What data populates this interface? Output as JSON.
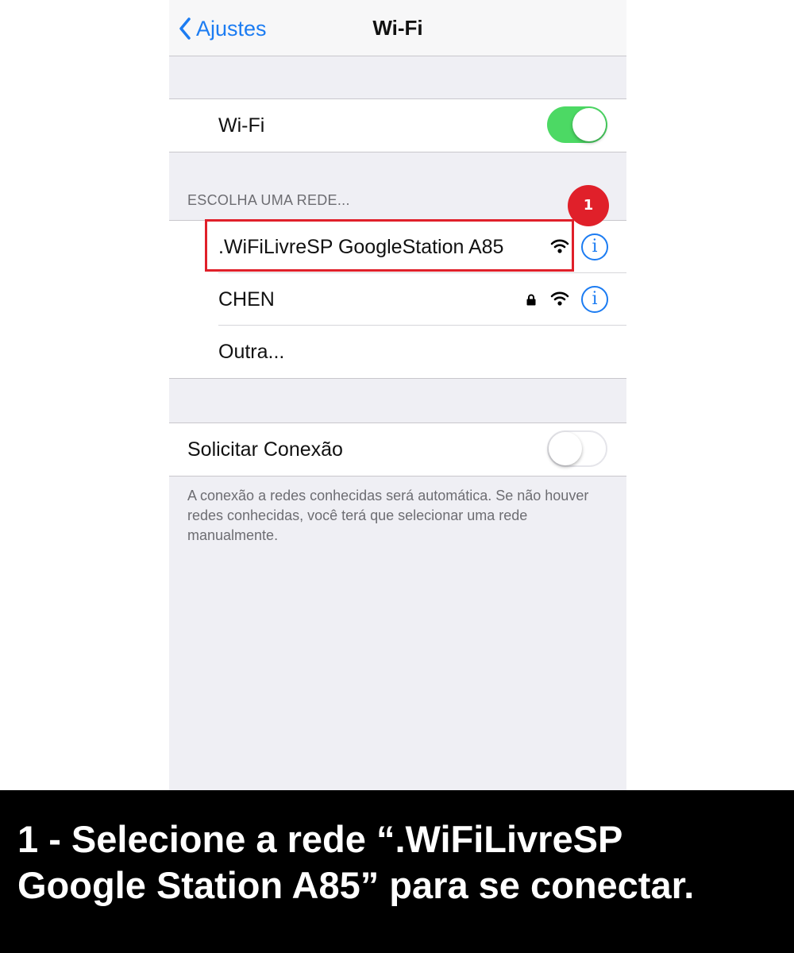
{
  "navbar": {
    "back_label": "Ajustes",
    "title": "Wi-Fi"
  },
  "wifi_toggle": {
    "label": "Wi-Fi",
    "state": "on",
    "color": "#4cd964"
  },
  "networks": {
    "header": "ESCOLHA UMA REDE...",
    "items": [
      {
        "name": ".WiFiLivreSP GoogleStation A85",
        "secured": false,
        "icon": "wifi-icon"
      },
      {
        "name": "CHEN",
        "secured": true,
        "icon": "wifi-icon"
      },
      {
        "name": "Outra..."
      }
    ]
  },
  "ask_to_join": {
    "label": "Solicitar Conexão",
    "state": "off",
    "footer": "A conexão a redes conhecidas será automática. Se não houver redes conhecidas, você terá que selecionar uma rede manualmente."
  },
  "annotation": {
    "step_number": "1",
    "color": "#e0202a",
    "caption": "1 - Selecione a rede “.WiFiLivreSP\nGoogle Station A85” para se conectar."
  },
  "accent_color": "#1c7cf2"
}
